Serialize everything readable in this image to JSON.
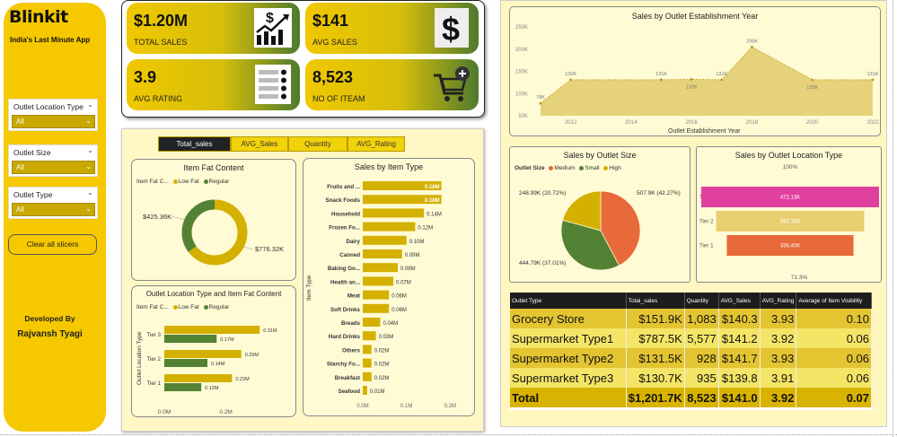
{
  "sidebar": {
    "logo": "Blinkit",
    "tagline": "India's Last Minute  App",
    "slicers": [
      {
        "label": "Outlet Location Type",
        "value": "All"
      },
      {
        "label": "Outlet Size",
        "value": "All"
      },
      {
        "label": "Outlet Type",
        "value": "All"
      }
    ],
    "clear_label": "Clear all slicers",
    "developed_by": "Developed By",
    "developer": "Rajvansh Tyagi"
  },
  "kpis": [
    {
      "value": "$1.20M",
      "caption": "TOTAL SALES",
      "icon": "chart-growth-icon"
    },
    {
      "value": "$141",
      "caption": "AVG SALES",
      "icon": "dollar-icon"
    },
    {
      "value": "3.9",
      "caption": "AVG RATING",
      "icon": "rating-list-icon"
    },
    {
      "value": "8,523",
      "caption": "NO OF ITEAM",
      "icon": "cart-add-icon"
    }
  ],
  "tabs": [
    "Total_sales",
    "AVG_Sales",
    "Quantity",
    "AVG_Rating"
  ],
  "active_tab": 0,
  "colors": {
    "gold": "#d4b000",
    "green": "#548235",
    "orange": "#e8693a",
    "magenta": "#e040a0",
    "sand": "#e8d070"
  },
  "charts": {
    "fat_donut": {
      "title": "Item Fat Content",
      "legend_title": "Item Fat C...",
      "legend": [
        "Low Fat",
        "Regular"
      ],
      "label_regular": "$425.36K",
      "label_lowfat": "$776.32K"
    },
    "item_type": {
      "title": "Sales by Item Type",
      "ylabel": "Item Type",
      "xticks": [
        "0.0M",
        "0.1M",
        "0.2M"
      ]
    },
    "loc_fat": {
      "title": "Outlet Location Type and Item Fat Content",
      "legend_title": "Item Fat C...",
      "legend": [
        "Low Fat",
        "Regular"
      ],
      "ylabel": "Outlet Location Type",
      "xticks": [
        "0.0M",
        "0.2M"
      ]
    },
    "est_year": {
      "title": "Sales by Outlet Establishment Year",
      "xlabel": "Outlet Establishment Year",
      "yticks": [
        "250K",
        "200K",
        "150K",
        "100K",
        "50K"
      ],
      "xticks": [
        "2012",
        "2014",
        "2016",
        "2018",
        "2020",
        "2022"
      ]
    },
    "size_pie": {
      "title": "Sales by Outlet Size",
      "legend_title": "Outlet Size",
      "legend": [
        "Medium",
        "Small",
        "High"
      ],
      "labels": [
        "507.9K (42.27%)",
        "444.79K (37.01%)",
        "248.99K (20.72%)"
      ]
    },
    "loc_funnel": {
      "title": "Sales by Outlet Location Type",
      "top_pct": "100%",
      "bottom_pct": "71.3%"
    }
  },
  "chart_data": [
    {
      "type": "pie",
      "title": "Item Fat Content",
      "categories": [
        "Low Fat",
        "Regular"
      ],
      "values": [
        776.32,
        425.36
      ],
      "unit": "$K"
    },
    {
      "type": "bar",
      "title": "Sales by Item Type",
      "categories": [
        "Fruits and ...",
        "Snack Foods",
        "Household",
        "Frozen Fo...",
        "Dairy",
        "Canned",
        "Baking Go...",
        "Health an...",
        "Meat",
        "Soft Drinks",
        "Breads",
        "Hard Drinks",
        "Others",
        "Starchy Fo...",
        "Breakfast",
        "Seafood"
      ],
      "values": [
        0.18,
        0.18,
        0.14,
        0.12,
        0.1,
        0.09,
        0.08,
        0.07,
        0.06,
        0.06,
        0.04,
        0.03,
        0.02,
        0.02,
        0.02,
        0.01
      ],
      "labels": [
        "0.18M",
        "0.18M",
        "0.14M",
        "0.12M",
        "0.10M",
        "0.09M",
        "0.08M",
        "0.07M",
        "0.06M",
        "0.06M",
        "0.04M",
        "0.03M",
        "0.02M",
        "0.02M",
        "0.02M",
        "0.01M"
      ],
      "xlim": [
        0,
        0.23
      ]
    },
    {
      "type": "bar",
      "title": "Outlet Location Type and Item Fat Content",
      "categories": [
        "Tier 3",
        "Tier 2",
        "Tier 1"
      ],
      "series": [
        {
          "name": "Low Fat",
          "values": [
            0.31,
            0.25,
            0.22
          ],
          "labels": [
            "0.31M",
            "0.25M",
            "0.22M"
          ]
        },
        {
          "name": "Regular",
          "values": [
            0.17,
            0.14,
            0.12
          ],
          "labels": [
            "0.17M",
            "0.14M",
            "0.12M"
          ]
        }
      ],
      "xlim": [
        0,
        0.35
      ]
    },
    {
      "type": "area",
      "title": "Sales by Outlet Establishment Year",
      "x": [
        2011,
        2012,
        2015,
        2016,
        2017,
        2018,
        2020,
        2022
      ],
      "values": [
        78,
        131,
        131,
        132,
        131,
        205,
        131,
        131
      ],
      "labels": [
        "78K",
        "130K",
        "131K",
        "132K",
        "131K",
        "205K",
        "129K",
        "131K"
      ],
      "ylim": [
        50,
        250
      ],
      "unit": "K"
    },
    {
      "type": "pie",
      "title": "Sales by Outlet Size",
      "categories": [
        "Medium",
        "Small",
        "High"
      ],
      "values": [
        507.9,
        444.79,
        248.99
      ],
      "unit": "K"
    },
    {
      "type": "bar",
      "title": "Sales by Outlet Location Type",
      "categories": [
        "Tier 3",
        "Tier 2",
        "Tier 1"
      ],
      "values": [
        472.13,
        393.15,
        336.4
      ],
      "labels": [
        "472.13K",
        "393.15K",
        "336.40K"
      ]
    },
    {
      "type": "table",
      "columns": [
        "Outlet Type",
        "Total_sales",
        "Quantity",
        "AVG_Sales",
        "AVG_Rating",
        "Average of Item Visibility"
      ],
      "rows": [
        [
          "Grocery Store",
          "$151.9K",
          "1,083",
          "$140.3",
          "3.93",
          "0.10"
        ],
        [
          "Supermarket Type1",
          "$787.5K",
          "5,577",
          "$141.2",
          "3.92",
          "0.06"
        ],
        [
          "Supermarket Type2",
          "$131.5K",
          "928",
          "$141.7",
          "3.93",
          "0.06"
        ],
        [
          "Supermarket Type3",
          "$130.7K",
          "935",
          "$139.8",
          "3.91",
          "0.06"
        ],
        [
          "Total",
          "$1,201.7K",
          "8,523",
          "$141.0",
          "3.92",
          "0.07"
        ]
      ]
    }
  ]
}
